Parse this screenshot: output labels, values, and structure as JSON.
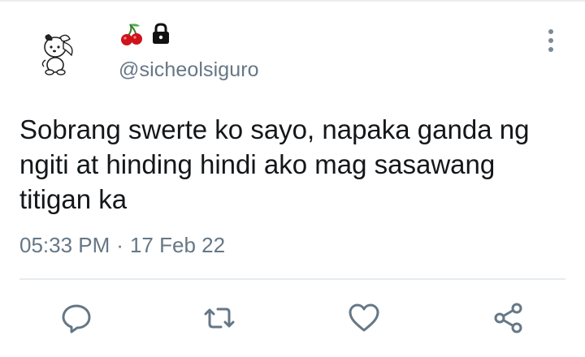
{
  "tweet": {
    "display_name_icons": [
      "cherries-icon",
      "lock-icon"
    ],
    "handle": "@sicheolsiguro",
    "text": "Sobrang swerte ko sayo, napaka ganda ng ngiti at hinding hindi ako mag sasawang titigan ka",
    "time": "05:33 PM",
    "separator": "·",
    "date": "17 Feb 22"
  },
  "actions": [
    "reply-icon",
    "retweet-icon",
    "like-icon",
    "share-icon"
  ],
  "colors": {
    "secondary_text": "#657786",
    "icon_gray": "#657786",
    "cherry_red": "#d0121b",
    "divider": "#e6ecf0"
  }
}
